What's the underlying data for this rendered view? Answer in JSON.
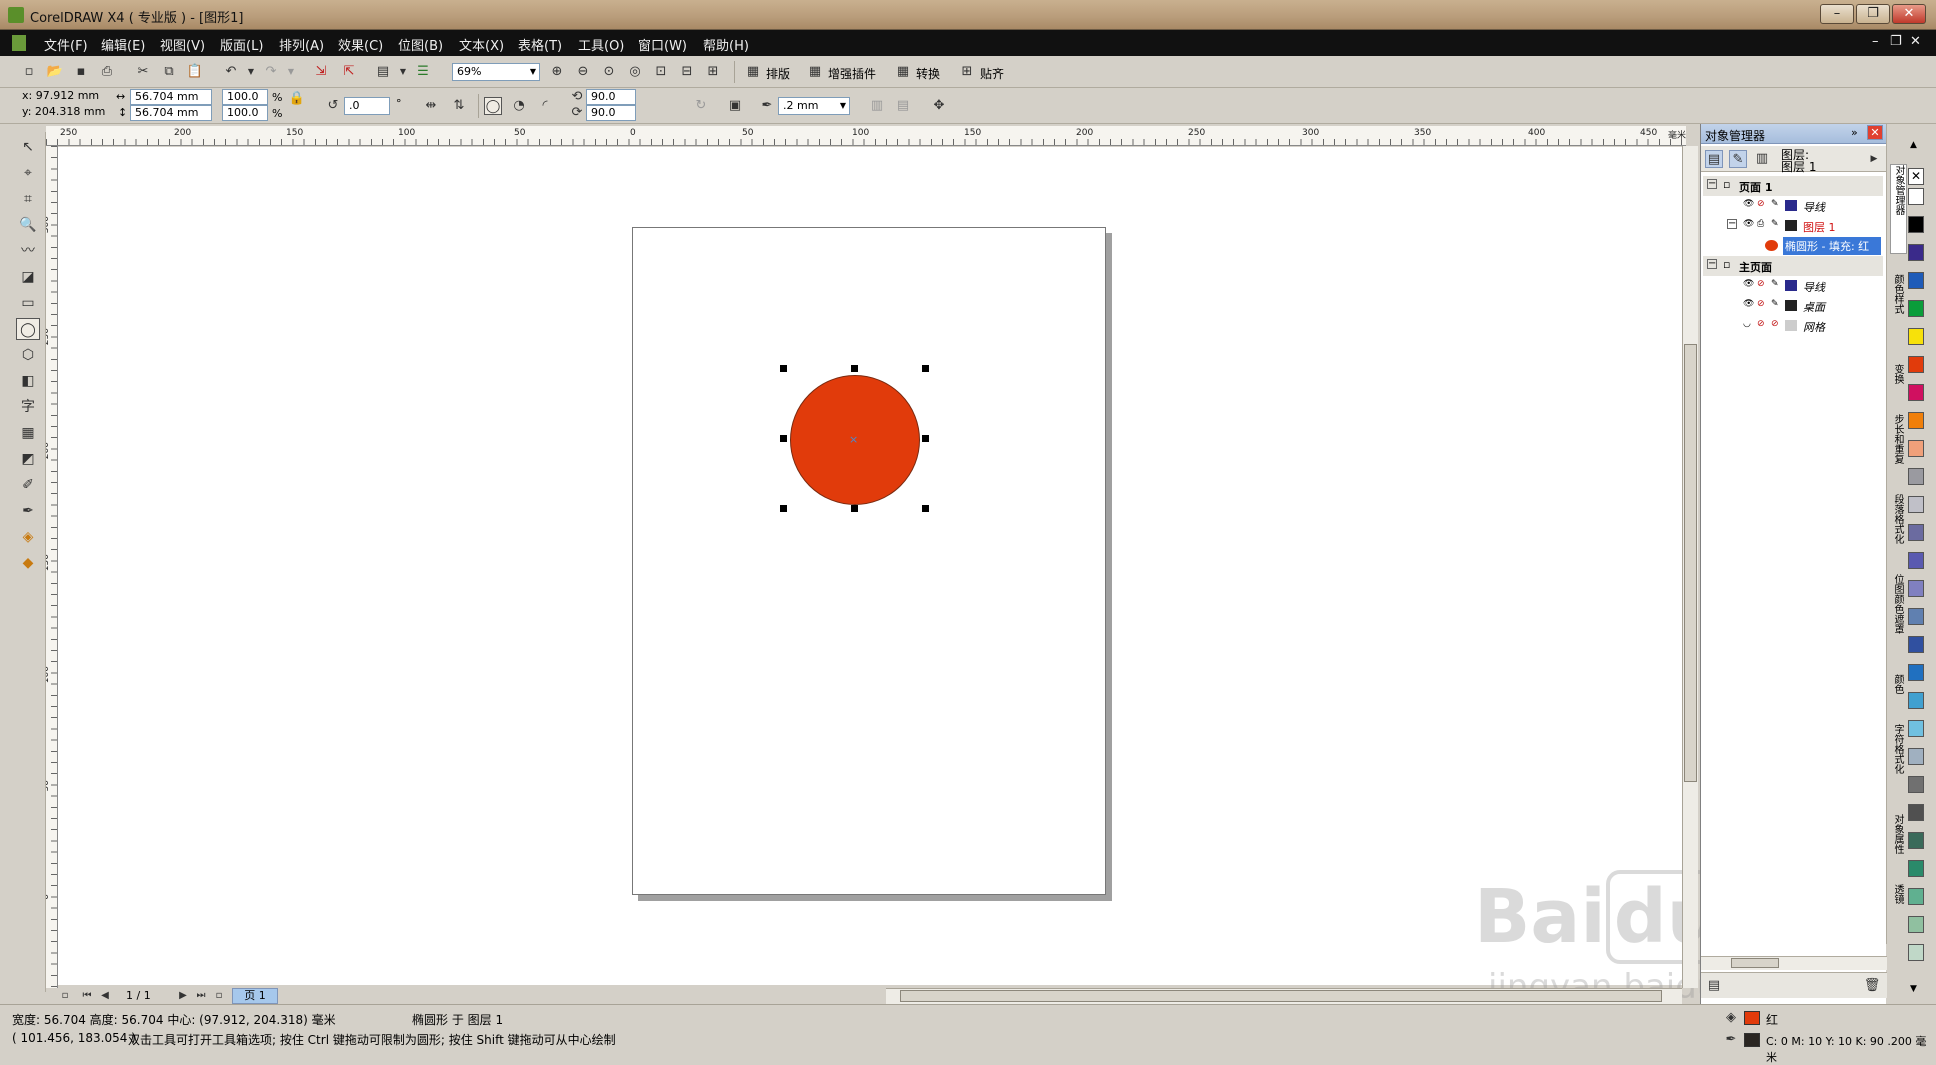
{
  "window": {
    "title": "CorelDRAW X4 ( 专业版 ) - [图形1]",
    "controls": [
      "–",
      "❐",
      "✕"
    ]
  },
  "menu": [
    "文件(F)",
    "编辑(E)",
    "视图(V)",
    "版面(L)",
    "排列(A)",
    "效果(C)",
    "位图(B)",
    "文本(X)",
    "表格(T)",
    "工具(O)",
    "窗口(W)",
    "帮助(H)"
  ],
  "toolbar": {
    "zoom": "69%",
    "buttons": [
      "排版",
      "增强插件",
      "转换",
      "贴齐"
    ]
  },
  "propbar": {
    "x": "x: 97.912 mm",
    "y": "y: 204.318 mm",
    "w": "56.704 mm",
    "h": "56.704 mm",
    "scale_x": "100.0",
    "scale_y": "100.0",
    "pct": "%",
    "rotation": ".0",
    "deg": "°",
    "start_angle": "90.0",
    "end_angle": "90.0",
    "outline": ".2 mm"
  },
  "ruler": {
    "h_labels": [
      "250",
      "200",
      "150",
      "100",
      "50",
      "0",
      "50",
      "100",
      "150",
      "200",
      "250",
      "300",
      "350",
      "400",
      "450"
    ],
    "v_labels": [
      "300",
      "250",
      "200",
      "150",
      "100",
      "50",
      "0"
    ],
    "unit": "毫米"
  },
  "shape": {
    "fill": "#e13b0b",
    "outline": "#7a2a10"
  },
  "pager": {
    "count": "1 / 1",
    "tab": "页 1"
  },
  "docker": {
    "title": "对象管理器",
    "layer_head": [
      "图层:",
      "图层 1"
    ],
    "tree": [
      {
        "label": "页面 1",
        "bold": true
      },
      {
        "label": "导线",
        "color": "#2a2a8c"
      },
      {
        "label": "图层 1",
        "color": "#d01010"
      },
      {
        "label": "椭圆形 - 填充: 红",
        "selected": true
      },
      {
        "label": "主页面",
        "bold": true
      },
      {
        "label": "导线",
        "color": "#2a2a8c"
      },
      {
        "label": "桌面",
        "color": "#222"
      },
      {
        "label": "网格",
        "color": "#999"
      }
    ],
    "side_tabs": [
      "对象管理器",
      "颜色样式",
      "变换",
      "步长和重复",
      "段落格式化",
      "位图颜色遮罩",
      "颜色",
      "字符格式化",
      "对象属性",
      "透镜"
    ]
  },
  "palette": [
    "#ffffff",
    "#000000",
    "#3a2a8a",
    "#1e5bb8",
    "#0a9d3a",
    "#f7e10a",
    "#e13b0b",
    "#d01060",
    "#f07f0a",
    "#f0a07a",
    "#9a9aa0",
    "#c0c0c8",
    "#6b6ba0",
    "#5a5ab0",
    "#8080c0",
    "#6080b0",
    "#3050a0",
    "#2070c0",
    "#40a0d0",
    "#70c0e0",
    "#a0b0c0",
    "#707070",
    "#505050",
    "#3a6a5a",
    "#2a8a6a",
    "#60b090",
    "#90c0a0",
    "#c0d8c8"
  ],
  "status": {
    "line1": "宽度: 56.704  高度: 56.704  中心: (97.912, 204.318)  毫米",
    "layer_info": "椭圆形 于 图层 1",
    "line2": "( 101.456, 183.054 )",
    "hint": "双击工具可打开工具箱选项; 按住 Ctrl 键拖动可限制为圆形; 按住 Shift 键拖动可从中心绘制",
    "fill_name": "红",
    "outline_info": "C: 0 M: 10 Y: 10 K: 90  .200 毫米"
  },
  "watermark": [
    "Bai",
    "du",
    "经验",
    "jingyan.baidu.com"
  ]
}
